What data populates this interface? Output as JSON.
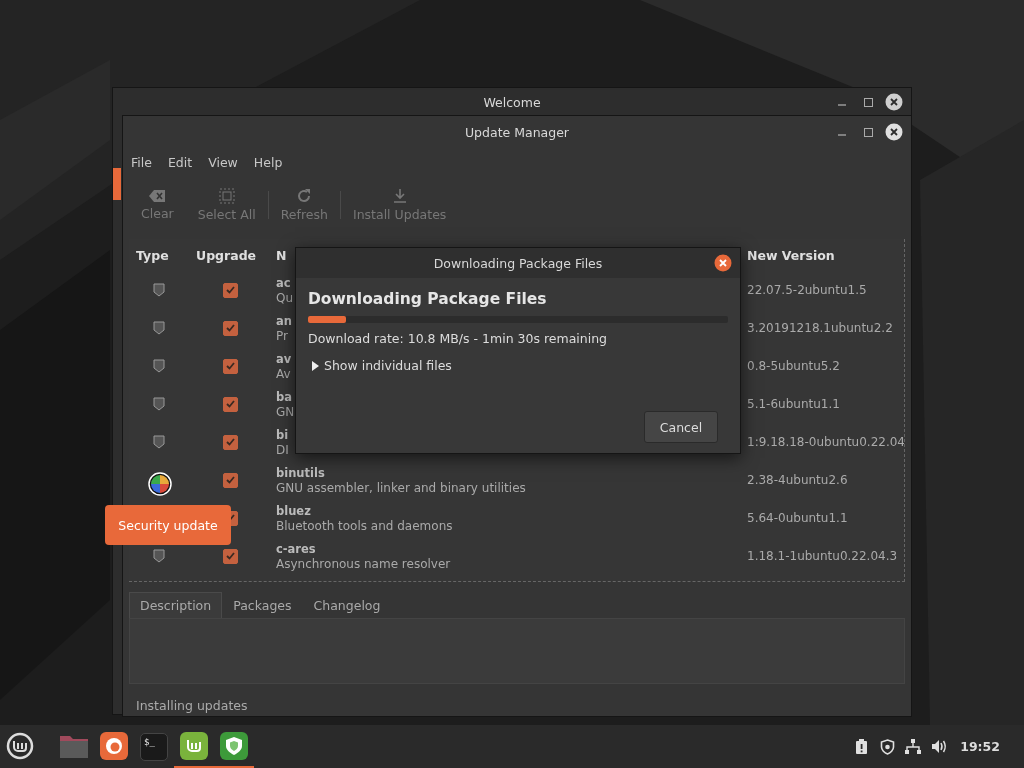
{
  "back_window": {
    "title": "Welcome"
  },
  "window": {
    "title": "Update Manager"
  },
  "menu": [
    "File",
    "Edit",
    "View",
    "Help"
  ],
  "toolbar": [
    {
      "kind": "clear",
      "label": "Clear",
      "disabled": true
    },
    {
      "kind": "selectall",
      "label": "Select All",
      "disabled": true
    },
    {
      "kind": "refresh",
      "label": "Refresh",
      "disabled": true
    },
    {
      "kind": "install",
      "label": "Install Updates",
      "disabled": true
    }
  ],
  "table": {
    "columns": [
      "Type",
      "Upgrade",
      "N",
      "New Version"
    ],
    "rows": [
      {
        "name": "ac",
        "description": "Qu",
        "checked": true,
        "version": "22.07.5-2ubuntu1.5"
      },
      {
        "name": "an",
        "description": "Pr",
        "checked": true,
        "version": "3.20191218.1ubuntu2.2"
      },
      {
        "name": "av",
        "description": "Av",
        "checked": true,
        "version": "0.8-5ubuntu5.2"
      },
      {
        "name": "ba",
        "description": "GN",
        "checked": true,
        "version": "5.1-6ubuntu1.1"
      },
      {
        "name": "bi",
        "description": "DI",
        "checked": true,
        "version": "1:9.18.18-0ubuntu0.22.04"
      },
      {
        "name": "binutils",
        "description": "GNU assembler, linker and binary utilities",
        "checked": true,
        "version": "2.38-4ubuntu2.6"
      },
      {
        "name": "bluez",
        "description": "Bluetooth tools and daemons",
        "checked": true,
        "type_hidden": true,
        "version": "5.64-0ubuntu1.1"
      },
      {
        "name": "c-ares",
        "description": "Asynchronous name resolver",
        "checked": true,
        "version": "1.18.1-1ubuntu0.22.04.3"
      }
    ]
  },
  "tooltip": "Security update",
  "tabs": [
    {
      "label": "Description",
      "selected": true
    },
    {
      "label": "Packages",
      "selected": false
    },
    {
      "label": "Changelog",
      "selected": false
    }
  ],
  "status": "Installing updates",
  "dialog": {
    "title": "Downloading Package Files",
    "heading": "Downloading Package Files",
    "level": 0.09,
    "rate": "Download rate: 10.8 MB/s - 1min 30s remaining",
    "expander": "Show individual files",
    "expanded": false,
    "cancel": "Cancel"
  },
  "taskbar": {
    "apps": [
      {
        "kind": "menu",
        "active": false
      },
      {
        "kind": "files",
        "active": false
      },
      {
        "kind": "browser",
        "active": false
      },
      {
        "kind": "terminal",
        "label": "$_",
        "active": false
      },
      {
        "kind": "updater",
        "active": true
      },
      {
        "kind": "shield",
        "active": true
      }
    ],
    "tray": [
      {
        "kind": "notice"
      },
      {
        "kind": "shield"
      },
      {
        "kind": "network"
      },
      {
        "kind": "volume"
      }
    ],
    "clock": "19:52"
  }
}
